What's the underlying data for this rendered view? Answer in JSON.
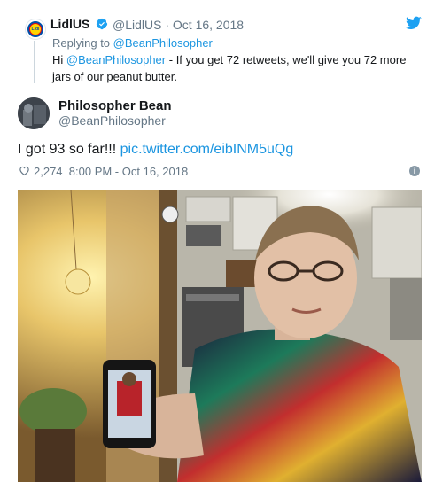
{
  "quoted": {
    "avatar_text": "Lidl",
    "name": "LidlUS",
    "handle": "@LidlUS",
    "separator": "·",
    "date": "Oct 16, 2018",
    "replying_prefix": "Replying to",
    "replying_handle": "@BeanPhilosopher",
    "text_prefix": "Hi",
    "text_mention": "@BeanPhilosopher",
    "text_rest": "- If you get 72 retweets, we'll give you 72 more jars of our peanut butter."
  },
  "tweet": {
    "name": "Philosopher Bean",
    "handle": "@BeanPhilosopher",
    "text": "I got 93 so far!!!",
    "link": "pic.twitter.com/eibINM5uQg",
    "likes": "2,274",
    "time": "8:00 PM - Oct 16, 2018"
  },
  "icons": {
    "verified": "verified-badge-icon",
    "twitter": "twitter-bird-icon",
    "heart": "heart-icon",
    "info": "info-icon"
  },
  "colors": {
    "link": "#1b95e0",
    "muted": "#657786",
    "verified": "#1da1f2"
  }
}
